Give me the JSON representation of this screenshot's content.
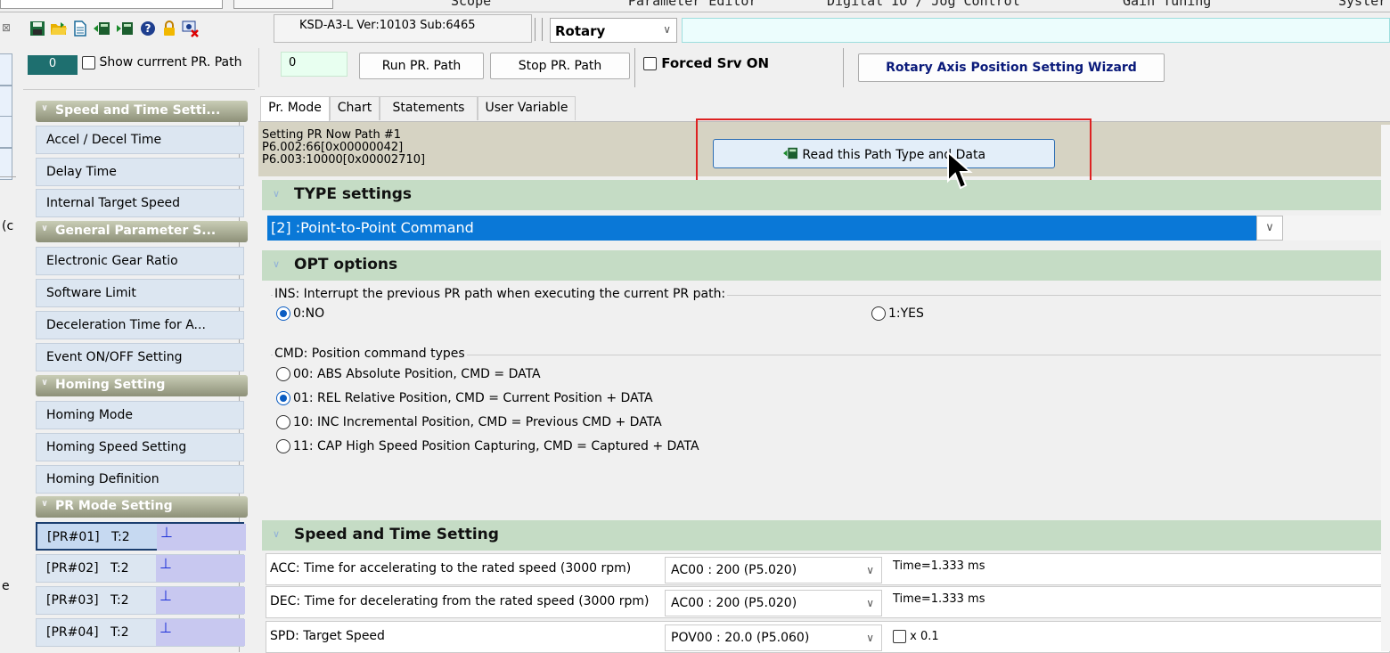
{
  "top_menu": {
    "items": [
      "Scope",
      "Parameter Editor",
      "Digital IO / Jog Control",
      "Gain Tuning",
      "Syster"
    ]
  },
  "toolbar": {
    "icons": [
      "save-icon",
      "open-folder-icon",
      "document-icon",
      "read-drive-icon",
      "write-drive-icon",
      "help-icon",
      "lock-icon",
      "disconnect-icon"
    ],
    "device_label": "KSD-A3-L Ver:10103 Sub:6465",
    "mode_select": "Rotary",
    "close_glyph": "⊠"
  },
  "row2": {
    "path_number": "0",
    "show_current_label": "Show currrent PR. Path",
    "value_box": "0",
    "run_button": "Run PR. Path",
    "stop_button": "Stop PR. Path",
    "forced_srv_label": "Forced Srv ON",
    "wizard_button": "Rotary Axis Position Setting Wizard"
  },
  "left_edge": {
    "fragment_1": "(c",
    "fragment_2": "e"
  },
  "sidebar": {
    "speed_section": "Speed and Time Setti...",
    "speed_items": [
      "Accel / Decel Time",
      "Delay Time",
      "Internal Target Speed"
    ],
    "general_section": "General Parameter S...",
    "general_items": [
      "Electronic Gear Ratio",
      "Software Limit",
      "Deceleration Time for A...",
      "Event ON/OFF Setting"
    ],
    "homing_section": "Homing Setting",
    "homing_items": [
      "Homing Mode",
      "Homing Speed Setting",
      "Homing Definition"
    ],
    "pr_section": "PR Mode Setting",
    "pr_items": [
      {
        "label": "[PR#01]   T:2",
        "mark": "⊥"
      },
      {
        "label": "[PR#02]   T:2",
        "mark": "⊥"
      },
      {
        "label": "[PR#03]   T:2",
        "mark": "⊥"
      },
      {
        "label": "[PR#04]   T:2",
        "mark": "⊥"
      }
    ]
  },
  "tabs": [
    "Pr. Mode",
    "Chart",
    "Statements",
    "User Variable"
  ],
  "info": {
    "line1": "Setting PR Now Path #1",
    "line2": "P6.002:66[0x00000042]",
    "line3": "P6.003:10000[0x00002710]",
    "read_button": "Read this Path Type and Data"
  },
  "type_settings": {
    "title": "TYPE settings",
    "selected": "[2] :Point-to-Point Command"
  },
  "opt_options": {
    "title": "OPT options",
    "ins_group": "INS: Interrupt the previous PR path when executing the current PR path:",
    "ins_no": "0:NO",
    "ins_yes": "1:YES",
    "cmd_group": "CMD: Position command types",
    "cmd_options": [
      "00: ABS Absolute Position, CMD = DATA",
      "01: REL Relative Position, CMD = Current Position + DATA",
      "10: INC Incremental Position, CMD = Previous CMD + DATA",
      "11: CAP High Speed Position Capturing, CMD = Captured + DATA"
    ],
    "cmd_selected_index": 1
  },
  "speed_time": {
    "title": "Speed and Time Setting",
    "rows": [
      {
        "label": "ACC: Time for accelerating to the rated speed (3000 rpm)",
        "value": "AC00 : 200 (P5.020)",
        "extra": "Time=1.333 ms"
      },
      {
        "label": "DEC: Time for decelerating from the rated speed (3000 rpm)",
        "value": "AC00 : 200 (P5.020)",
        "extra": "Time=1.333 ms"
      },
      {
        "label": "SPD: Target Speed",
        "value": "POV00 : 20.0 (P5.060)",
        "extra": "x 0.1"
      }
    ]
  },
  "colors": {
    "accent_blue": "#0a78d7",
    "section_green": "#c5dcc5",
    "highlight_red": "#dd2222",
    "sidebar_header": "#8d9078"
  }
}
